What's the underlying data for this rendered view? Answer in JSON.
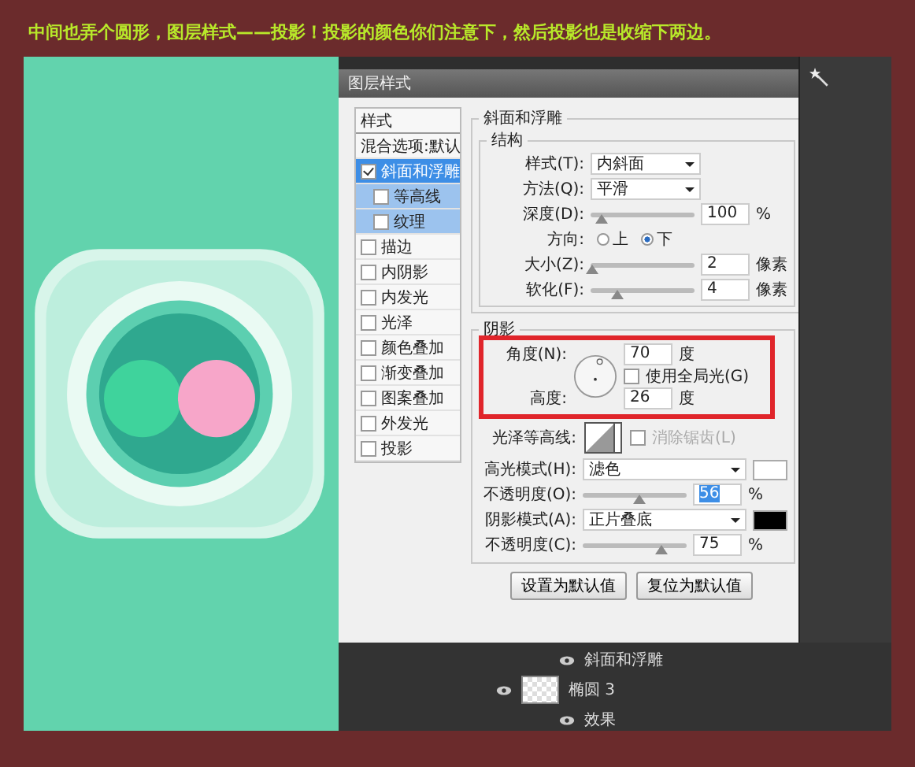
{
  "caption": "中间也弄个圆形，图层样式——投影！投影的颜色你们注意下，然后投影也是收缩下两边。",
  "dialog": {
    "title": "图层样式",
    "styles": [
      {
        "label": "样式",
        "kind": "header",
        "selected": false
      },
      {
        "label": "混合选项:默认",
        "kind": "plain",
        "selected": false
      },
      {
        "label": "斜面和浮雕",
        "kind": "check",
        "checked": true,
        "selected": true,
        "children": [
          {
            "label": "等高线",
            "checked": false,
            "selected": true
          },
          {
            "label": "纹理",
            "checked": false,
            "selected": true
          }
        ]
      },
      {
        "label": "描边",
        "kind": "check",
        "checked": false,
        "selected": false
      },
      {
        "label": "内阴影",
        "kind": "check",
        "checked": false,
        "selected": false
      },
      {
        "label": "内发光",
        "kind": "check",
        "checked": false,
        "selected": false
      },
      {
        "label": "光泽",
        "kind": "check",
        "checked": false,
        "selected": false
      },
      {
        "label": "颜色叠加",
        "kind": "check",
        "checked": false,
        "selected": false
      },
      {
        "label": "渐变叠加",
        "kind": "check",
        "checked": false,
        "selected": false
      },
      {
        "label": "图案叠加",
        "kind": "check",
        "checked": false,
        "selected": false
      },
      {
        "label": "外发光",
        "kind": "check",
        "checked": false,
        "selected": false
      },
      {
        "label": "投影",
        "kind": "check",
        "checked": false,
        "selected": false
      }
    ],
    "section_title": "斜面和浮雕",
    "structure": {
      "title": "结构",
      "rows": [
        {
          "kind": "select",
          "label": "样式(T):",
          "value": "内斜面"
        },
        {
          "kind": "select",
          "label": "方法(Q):",
          "value": "平滑"
        },
        {
          "kind": "slider",
          "label": "深度(D):",
          "level": 0.1,
          "value": "100",
          "unit": "%"
        },
        {
          "kind": "radio",
          "label": "方向:",
          "options": [
            {
              "label": "上",
              "selected": false
            },
            {
              "label": "下",
              "selected": true
            }
          ]
        },
        {
          "kind": "slider",
          "label": "大小(Z):",
          "level": 0.02,
          "value": "2",
          "unit": "像素"
        },
        {
          "kind": "slider",
          "label": "软化(F):",
          "level": 0.25,
          "value": "4",
          "unit": "像素"
        }
      ]
    },
    "shading": {
      "title": "阴影",
      "angle_label": "角度(N):",
      "angle": "70",
      "angle_unit": "度",
      "global_light": {
        "label": "使用全局光(G)",
        "checked": false
      },
      "altitude_label": "高度:",
      "altitude": "26",
      "altitude_unit": "度",
      "gloss_label": "光泽等高线:",
      "anti_alias": {
        "label": "消除锯齿(L)",
        "checked": false
      },
      "rows": [
        {
          "kind": "mode",
          "label": "高光模式(H):",
          "value": "滤色",
          "color": "#ffffff"
        },
        {
          "kind": "slider",
          "label": "不透明度(O):",
          "level": 0.55,
          "value": "56",
          "unit": "%",
          "selected": true
        },
        {
          "kind": "mode",
          "label": "阴影模式(A):",
          "value": "正片叠底",
          "color": "#000000"
        },
        {
          "kind": "slider",
          "label": "不透明度(C):",
          "level": 0.75,
          "value": "75",
          "unit": "%",
          "selected": false
        }
      ]
    },
    "buttons": [
      "设置为默认值",
      "复位为默认值"
    ]
  },
  "layers": [
    {
      "label": "斜面和浮雕",
      "kind": "effect"
    },
    {
      "label": "椭圆 3",
      "kind": "layer"
    },
    {
      "label": "效果",
      "kind": "effects"
    }
  ]
}
